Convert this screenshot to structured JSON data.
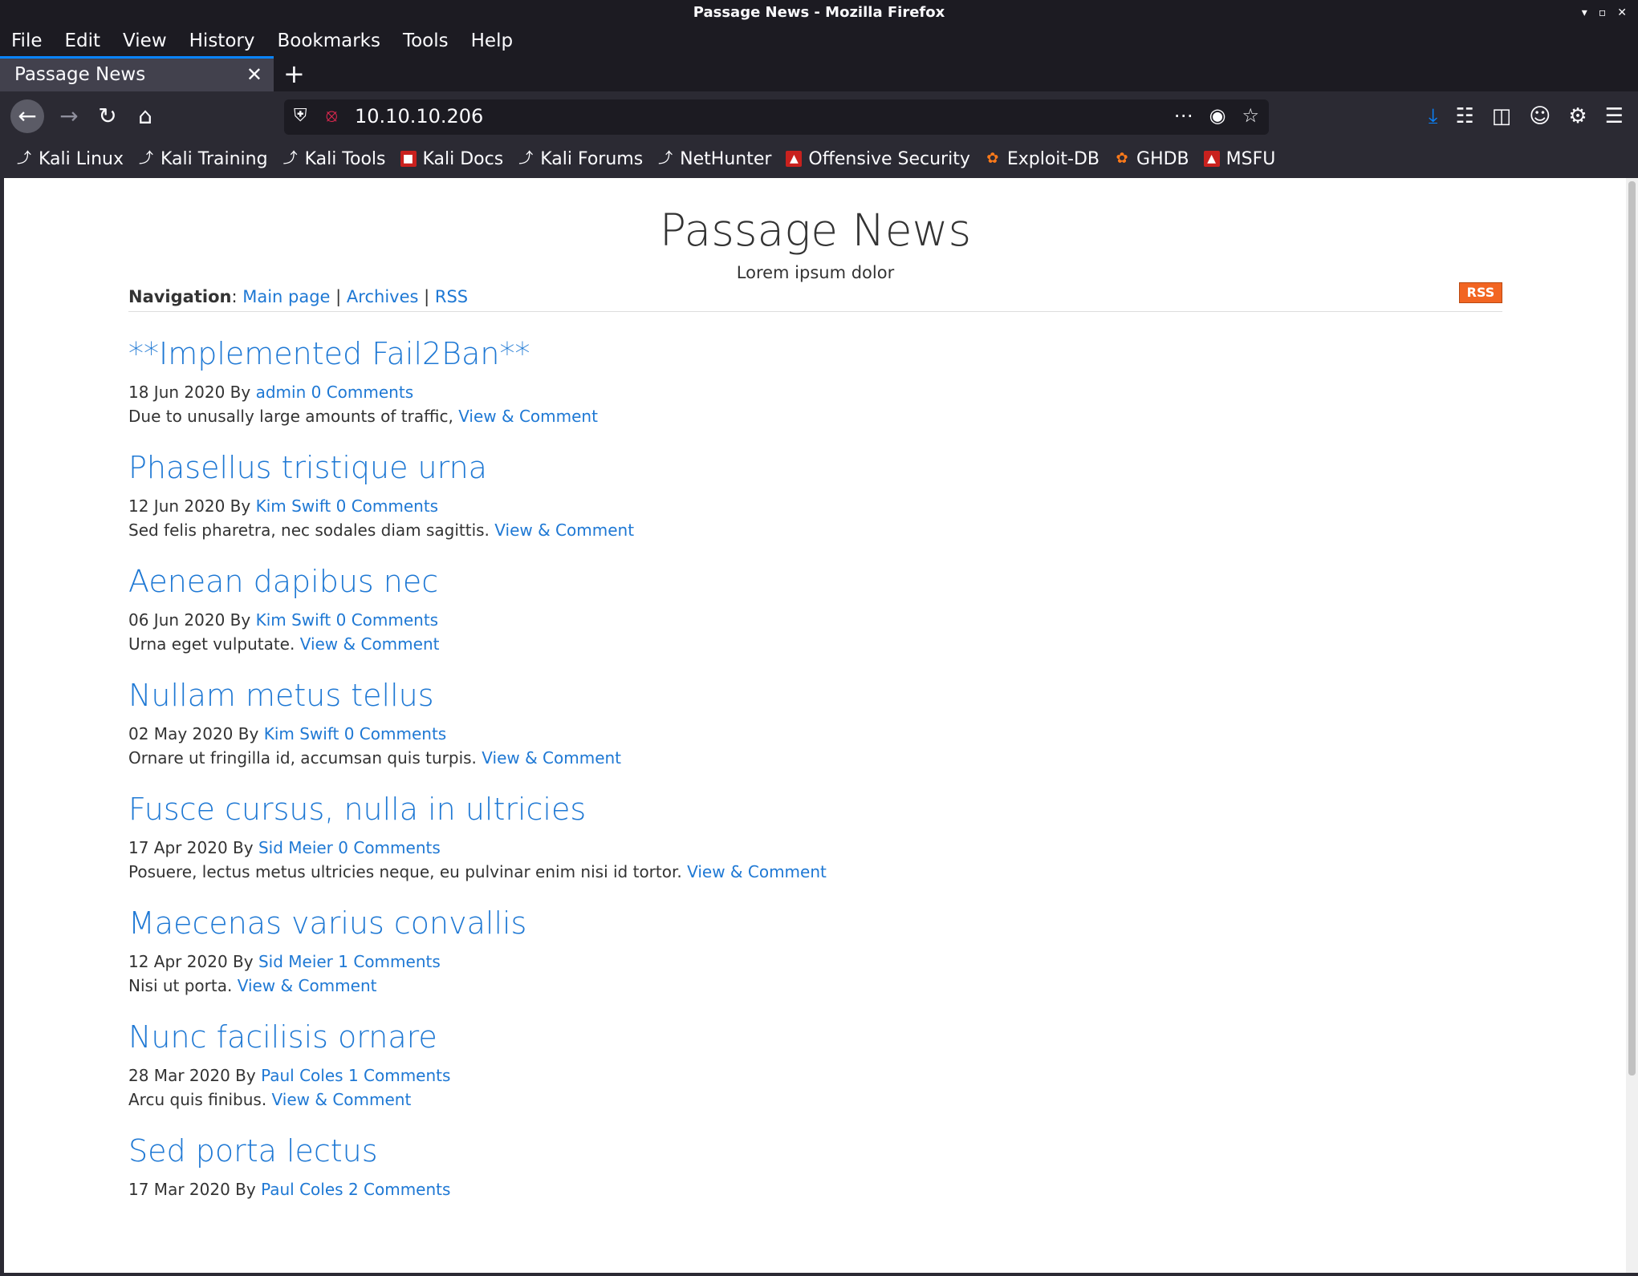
{
  "window": {
    "title": "Passage News - Mozilla Firefox"
  },
  "menu": [
    "File",
    "Edit",
    "View",
    "History",
    "Bookmarks",
    "Tools",
    "Help"
  ],
  "tab": {
    "title": "Passage News"
  },
  "urlbar": {
    "url": "10.10.10.206"
  },
  "bookmarks": [
    {
      "label": "Kali Linux",
      "icon": "dragon-icon"
    },
    {
      "label": "Kali Training",
      "icon": "dragon-icon"
    },
    {
      "label": "Kali Tools",
      "icon": "dragon-icon"
    },
    {
      "label": "Kali Docs",
      "icon": "red-doc-icon"
    },
    {
      "label": "Kali Forums",
      "icon": "dragon-icon"
    },
    {
      "label": "NetHunter",
      "icon": "dragon-icon"
    },
    {
      "label": "Offensive Security",
      "icon": "flask-icon"
    },
    {
      "label": "Exploit-DB",
      "icon": "bug-icon"
    },
    {
      "label": "GHDB",
      "icon": "bug-icon"
    },
    {
      "label": "MSFU",
      "icon": "flask-icon"
    }
  ],
  "site": {
    "title": "Passage News",
    "tagline": "Lorem ipsum dolor",
    "nav_label": "Navigation",
    "nav_links": [
      "Main page",
      "Archives",
      "RSS"
    ],
    "rss_badge": "RSS"
  },
  "posts": [
    {
      "title": "**Implemented Fail2Ban**",
      "date": "18 Jun 2020",
      "by": "By",
      "author": "admin",
      "comments": "0 Comments",
      "excerpt": "Due to unusally large amounts of traffic,",
      "link": "View & Comment"
    },
    {
      "title": "Phasellus tristique urna",
      "date": "12 Jun 2020",
      "by": "By",
      "author": "Kim Swift",
      "comments": "0 Comments",
      "excerpt": "Sed felis pharetra, nec sodales diam sagittis.",
      "link": "View & Comment"
    },
    {
      "title": "Aenean dapibus nec",
      "date": "06 Jun 2020",
      "by": "By",
      "author": "Kim Swift",
      "comments": "0 Comments",
      "excerpt": "Urna eget vulputate.",
      "link": "View & Comment"
    },
    {
      "title": "Nullam metus tellus",
      "date": "02 May 2020",
      "by": "By",
      "author": "Kim Swift",
      "comments": "0 Comments",
      "excerpt": "Ornare ut fringilla id, accumsan quis turpis.",
      "link": "View & Comment"
    },
    {
      "title": "Fusce cursus, nulla in ultricies",
      "date": "17 Apr 2020",
      "by": "By",
      "author": "Sid Meier",
      "comments": "0 Comments",
      "excerpt": "Posuere, lectus metus ultricies neque, eu pulvinar enim nisi id tortor.",
      "link": "View & Comment"
    },
    {
      "title": "Maecenas varius convallis",
      "date": "12 Apr 2020",
      "by": "By",
      "author": "Sid Meier",
      "comments": "1 Comments",
      "excerpt": "Nisi ut porta.",
      "link": "View & Comment"
    },
    {
      "title": "Nunc facilisis ornare",
      "date": "28 Mar 2020",
      "by": "By",
      "author": "Paul Coles",
      "comments": "1 Comments",
      "excerpt": "Arcu quis finibus.",
      "link": "View & Comment"
    },
    {
      "title": "Sed porta lectus",
      "date": "17 Mar 2020",
      "by": "By",
      "author": "Paul Coles",
      "comments": "2 Comments",
      "excerpt": "",
      "link": ""
    }
  ]
}
